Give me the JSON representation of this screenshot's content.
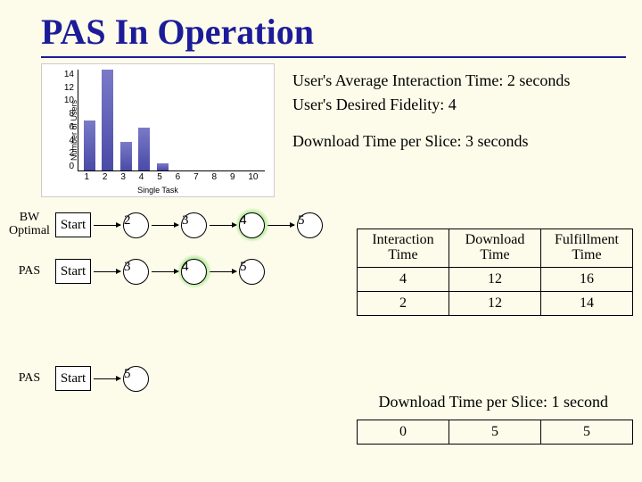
{
  "title": "PAS In Operation",
  "info": {
    "avg": "User's Average Interaction Time: 2 seconds",
    "fid": "User's Desired Fidelity: 4",
    "dl3": "Download Time per Slice: 3 seconds",
    "dl1": "Download Time per Slice: 1 second"
  },
  "chart_data": {
    "type": "bar",
    "categories": [
      "1",
      "2",
      "3",
      "4",
      "5",
      "6",
      "7",
      "8",
      "9",
      "10"
    ],
    "values": [
      7,
      14,
      4,
      6,
      1,
      0,
      0,
      0,
      0,
      0
    ],
    "ylabel": "Number of Users",
    "xlabel": "Single Task",
    "ylim": [
      0,
      14
    ],
    "yticks": [
      "0",
      "2",
      "4",
      "6",
      "8",
      "10",
      "12",
      "14"
    ]
  },
  "flows": [
    {
      "label": "BW Optimal",
      "start": "Start",
      "steps": [
        "2",
        "3",
        "4",
        "5"
      ],
      "halo_index": 2
    },
    {
      "label": "PAS",
      "start": "Start",
      "steps": [
        "3",
        "4",
        "5"
      ],
      "halo_index": 1
    },
    {
      "label": "PAS",
      "start": "Start",
      "steps": [
        "5"
      ],
      "halo_index": -1
    }
  ],
  "table": {
    "headers": [
      "Interaction Time",
      "Download Time",
      "Fulfillment Time"
    ],
    "rows": [
      [
        "4",
        "12",
        "16"
      ],
      [
        "2",
        "12",
        "14"
      ]
    ],
    "rows2": [
      [
        "0",
        "5",
        "5"
      ]
    ]
  }
}
